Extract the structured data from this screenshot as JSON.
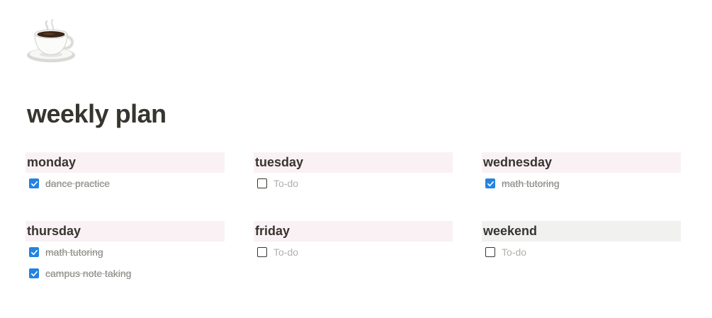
{
  "page": {
    "icon": "coffee-cup-icon",
    "title": "weekly plan"
  },
  "colors": {
    "header_pink": "#faf1f5",
    "header_gray": "#f1f1ef",
    "checkbox_blue": "#2383e2"
  },
  "days": [
    {
      "name": "monday",
      "header_color": "#faf1f5",
      "items": [
        {
          "text": "dance practice",
          "checked": true
        }
      ]
    },
    {
      "name": "tuesday",
      "header_color": "#faf1f5",
      "items": [
        {
          "text": "To-do",
          "checked": false,
          "placeholder": true
        }
      ]
    },
    {
      "name": "wednesday",
      "header_color": "#faf1f5",
      "items": [
        {
          "text": "math tutoring",
          "checked": true
        }
      ]
    },
    {
      "name": "thursday",
      "header_color": "#faf1f5",
      "items": [
        {
          "text": "math tutoring",
          "checked": true
        },
        {
          "text": "campus note taking",
          "checked": true
        }
      ]
    },
    {
      "name": "friday",
      "header_color": "#faf1f5",
      "items": [
        {
          "text": "To-do",
          "checked": false,
          "placeholder": true
        }
      ]
    },
    {
      "name": "weekend",
      "header_color": "#f1f1ef",
      "items": [
        {
          "text": "To-do",
          "checked": false,
          "placeholder": true
        }
      ]
    }
  ]
}
